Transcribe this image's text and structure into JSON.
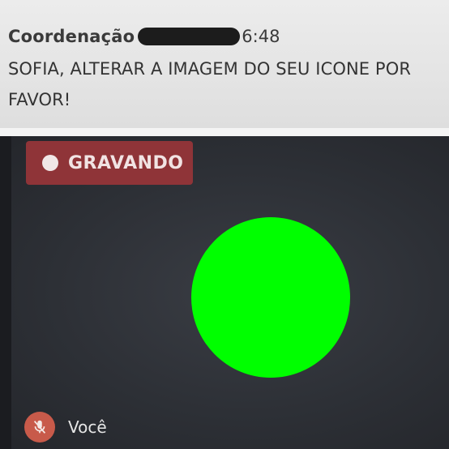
{
  "chat": {
    "sender": "Coordenação",
    "time": "6:48",
    "message": "SOFIA, ALTERAR A IMAGEM DO SEU ICONE POR FAVOR!"
  },
  "call": {
    "recording_label": "GRAVANDO",
    "avatar_color": "#00ff00",
    "self_label": "Você",
    "mic_state": "muted",
    "mic_icon": "mic-off-icon"
  },
  "colors": {
    "recording_badge": "#8f3438",
    "mic_button": "#c85a4a",
    "video_background": "#2d3036"
  }
}
